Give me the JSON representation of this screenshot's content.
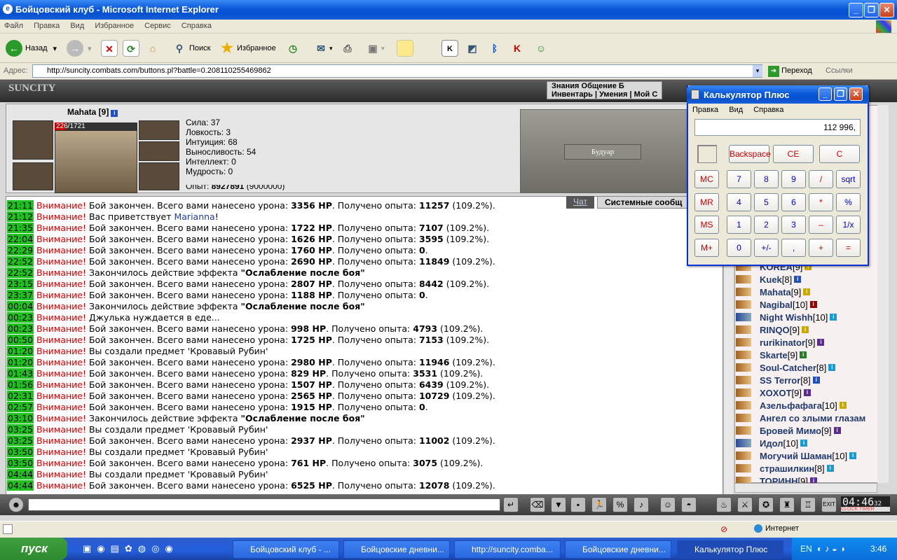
{
  "window": {
    "title": "Бойцовский клуб - Microsoft Internet Explorer"
  },
  "menu": [
    "Файл",
    "Правка",
    "Вид",
    "Избранное",
    "Сервис",
    "Справка"
  ],
  "toolbar": {
    "back": "Назад",
    "search": "Поиск",
    "favorites": "Избранное"
  },
  "address": {
    "label": "Адрес:",
    "url": "http://suncity.combats.com/buttons.pl?battle=0.208110255469862",
    "go": "Переход",
    "links": "Ссылки"
  },
  "game": {
    "logo": "SUNCITY",
    "tabs_row1": "Знания   Общение   Б",
    "tabs_row2": "Инвентарь | Умения | Мой С",
    "char_name": "Mahata [9]",
    "hp": "226/1721",
    "hp_fraction": 0.13,
    "stats": [
      "Сила: 37",
      "Ловкость: 3",
      "Интуиция: 68",
      "Выносливость: 54",
      "Интеллект: 0",
      "Мудрость: 0"
    ],
    "exp_label": "Опыт: ",
    "exp_value": "8927891",
    "exp_next": "(9000000)",
    "room": "Будуар"
  },
  "chat": {
    "tab_chat": "Чат",
    "tab_system": "Системные сообщ",
    "warn": "Внимание!",
    "lines": [
      {
        "t": "21:11",
        "pre": "Бой закончен. Всего вами нанесено урона: ",
        "dmg": "3356 HP",
        "mid": ". Получено опыта: ",
        "exp": "11257",
        "post": " (109.2%)."
      },
      {
        "t": "21:12",
        "text": "Вас приветствует ",
        "nick": "Marianna",
        "end": "!"
      },
      {
        "t": "21:35",
        "pre": "Бой закончен. Всего вами нанесено урона: ",
        "dmg": "1722 HP",
        "mid": ". Получено опыта: ",
        "exp": "7107",
        "post": " (109.2%)."
      },
      {
        "t": "22:04",
        "pre": "Бой закончен. Всего вами нанесено урона: ",
        "dmg": "1626 HP",
        "mid": ". Получено опыта: ",
        "exp": "3595",
        "post": " (109.2%)."
      },
      {
        "t": "22:29",
        "pre": "Бой закончен. Всего вами нанесено урона: ",
        "dmg": "1760 HP",
        "mid": ". Получено опыта: ",
        "exp": "0",
        "post": "."
      },
      {
        "t": "22:52",
        "pre": "Бой закончен. Всего вами нанесено урона: ",
        "dmg": "2690 HP",
        "mid": ". Получено опыта: ",
        "exp": "11849",
        "post": " (109.2%)."
      },
      {
        "t": "22:52",
        "effect": "Закончилось действие эффекта ",
        "ename": "\"Ослабление после боя\""
      },
      {
        "t": "23:15",
        "pre": "Бой закончен. Всего вами нанесено урона: ",
        "dmg": "2807 HP",
        "mid": ". Получено опыта: ",
        "exp": "8442",
        "post": " (109.2%)."
      },
      {
        "t": "23:37",
        "pre": "Бой закончен. Всего вами нанесено урона: ",
        "dmg": "1188 HP",
        "mid": ". Получено опыта: ",
        "exp": "0",
        "post": "."
      },
      {
        "t": "00:04",
        "effect": "Закончилось действие эффекта ",
        "ename": "\"Ослабление после боя\""
      },
      {
        "t": "00:23",
        "text": "Джулька нуждается в еде...",
        "nick": "",
        "end": ""
      },
      {
        "t": "00:23",
        "pre": "Бой закончен. Всего вами нанесено урона: ",
        "dmg": "998 HP",
        "mid": ". Получено опыта: ",
        "exp": "4793",
        "post": " (109.2%)."
      },
      {
        "t": "00:50",
        "pre": "Бой закончен. Всего вами нанесено урона: ",
        "dmg": "1725 HP",
        "mid": ". Получено опыта: ",
        "exp": "7153",
        "post": " (109.2%)."
      },
      {
        "t": "01:20",
        "text": "Вы создали предмет 'Кровавый Рубин'",
        "nick": "",
        "end": ""
      },
      {
        "t": "01:20",
        "pre": "Бой закончен. Всего вами нанесено урона: ",
        "dmg": "2980 HP",
        "mid": ". Получено опыта: ",
        "exp": "11946",
        "post": " (109.2%)."
      },
      {
        "t": "01:43",
        "pre": "Бой закончен. Всего вами нанесено урона: ",
        "dmg": "829 HP",
        "mid": ". Получено опыта: ",
        "exp": "3531",
        "post": " (109.2%)."
      },
      {
        "t": "01:56",
        "pre": "Бой закончен. Всего вами нанесено урона: ",
        "dmg": "1507 HP",
        "mid": ". Получено опыта: ",
        "exp": "6439",
        "post": " (109.2%)."
      },
      {
        "t": "02:31",
        "pre": "Бой закончен. Всего вами нанесено урона: ",
        "dmg": "2565 HP",
        "mid": ". Получено опыта: ",
        "exp": "10729",
        "post": " (109.2%)."
      },
      {
        "t": "02:57",
        "pre": "Бой закончен. Всего вами нанесено урона: ",
        "dmg": "1915 HP",
        "mid": ". Получено опыта: ",
        "exp": "0",
        "post": "."
      },
      {
        "t": "03:10",
        "effect": "Закончилось действие эффекта ",
        "ename": "\"Ослабление после боя\""
      },
      {
        "t": "03:25",
        "text": "Вы создали предмет 'Кровавый Рубин'",
        "nick": "",
        "end": ""
      },
      {
        "t": "03:25",
        "pre": "Бой закончен. Всего вами нанесено урона: ",
        "dmg": "2937 HP",
        "mid": ". Получено опыта: ",
        "exp": "11002",
        "post": " (109.2%)."
      },
      {
        "t": "03:50",
        "text": "Вы создали предмет 'Кровавый Рубин'",
        "nick": "",
        "end": ""
      },
      {
        "t": "03:50",
        "pre": "Бой закончен. Всего вами нанесено урона: ",
        "dmg": "761 HP",
        "mid": ". Получено опыта: ",
        "exp": "3075",
        "post": " (109.2%)."
      },
      {
        "t": "04:44",
        "text": "Вы создали предмет 'Кровавый Рубин'",
        "nick": "",
        "end": ""
      },
      {
        "t": "04:44",
        "pre": "Бой закончен. Всего вами нанесено урона: ",
        "dmg": "6525 HP",
        "mid": ". Получено опыта: ",
        "exp": "12078",
        "post": " (109.2%)."
      }
    ]
  },
  "users": [
    {
      "name": "KOREA",
      "lv": "[9]",
      "c": "#c9a800"
    },
    {
      "name": "Kuek",
      "lv": "[8]",
      "c": "#2050c0"
    },
    {
      "name": "Mahata",
      "lv": "[9]",
      "c": "#c9a800"
    },
    {
      "name": "Nagibal",
      "lv": "[10]",
      "c": "#900"
    },
    {
      "name": "Night Wishh",
      "lv": "[10]",
      "c": "#1a9ad0"
    },
    {
      "name": "RINQO",
      "lv": "[9]",
      "c": "#c9a800"
    },
    {
      "name": "rurikinator",
      "lv": "[9]",
      "c": "#5b2c8f"
    },
    {
      "name": "Skarte",
      "lv": "[9]",
      "c": "#2a7a2a"
    },
    {
      "name": "Soul-Catcher",
      "lv": "[8]",
      "c": "#1a9ad0"
    },
    {
      "name": "SS Terror",
      "lv": "[8]",
      "c": "#2050c0"
    },
    {
      "name": "XOXOT",
      "lv": "[9]",
      "c": "#5b2c8f"
    },
    {
      "name": "Азельфафага",
      "lv": "[10]",
      "c": "#c9a800"
    },
    {
      "name": "Ангел со злыми глазам",
      "lv": "",
      "c": ""
    },
    {
      "name": "Бровей Мимо",
      "lv": "[9]",
      "c": "#5b2c8f"
    },
    {
      "name": "Идол",
      "lv": "[10]",
      "c": "#1a9ad0"
    },
    {
      "name": "Могучий Шаман",
      "lv": "[10]",
      "c": "#1a9ad0"
    },
    {
      "name": "страшилкин",
      "lv": "[8]",
      "c": "#1a9ad0"
    },
    {
      "name": "ТОРИНН",
      "lv": "[9]",
      "c": "#5b2c8f"
    }
  ],
  "clock": {
    "time": "04:46",
    "sec": "32",
    "label": "CLOCK TIMER"
  },
  "statusbar": {
    "zone": "Интернет"
  },
  "calculator": {
    "title": "Калькулятор Плюс",
    "menu": [
      "Правка",
      "Вид",
      "Справка"
    ],
    "display": "112 996,",
    "buttons_top": [
      "Backspace",
      "CE",
      "C"
    ],
    "mem": [
      "MC",
      "MR",
      "MS",
      "M+"
    ],
    "rows": [
      [
        "7",
        "8",
        "9",
        "/",
        "sqrt"
      ],
      [
        "4",
        "5",
        "6",
        "*",
        "%"
      ],
      [
        "1",
        "2",
        "3",
        "–",
        "1/x"
      ],
      [
        "0",
        "+/-",
        ",",
        "+",
        "="
      ]
    ]
  },
  "taskbar": {
    "start": "пуск",
    "tasks": [
      "Бойцовский клуб - ...",
      "Бойцовские дневни...",
      "http://suncity.comba...",
      "Бойцовские дневни...",
      "Калькулятор Плюс"
    ],
    "lang": "EN",
    "time": "3:46"
  }
}
